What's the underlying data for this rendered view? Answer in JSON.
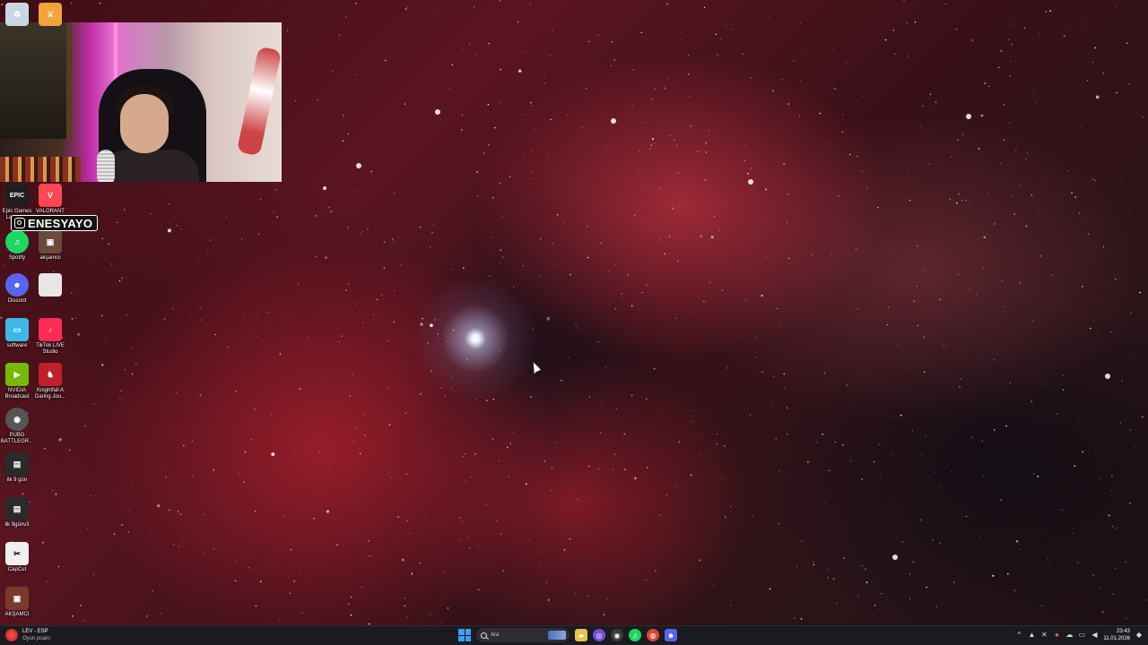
{
  "desktop": {
    "icons": [
      {
        "id": "recycle-bin",
        "label": "",
        "color": "#c9d7e4",
        "glyph": "♻"
      },
      {
        "id": "game-launcher-top",
        "label": "",
        "color": "#f2a33a",
        "glyph": "⚔"
      },
      {
        "id": "epic-games",
        "label": "Epic Games Launcher",
        "color": "#1f1f1f",
        "glyph": "EPIC"
      },
      {
        "id": "valorant",
        "label": "VALORANT",
        "color": "#ff4655",
        "glyph": "V"
      },
      {
        "id": "spotify",
        "label": "Spotify",
        "color": "#1ed760",
        "glyph": "♫"
      },
      {
        "id": "aksamcii",
        "label": "akşamcii",
        "color": "#6a4a3a",
        "glyph": "▣"
      },
      {
        "id": "discord",
        "label": "Discord",
        "color": "#5865f2",
        "glyph": "☻"
      },
      {
        "id": "blank-file",
        "label": "",
        "color": "#e6e6e6",
        "glyph": ""
      },
      {
        "id": "software",
        "label": "software",
        "color": "#3fb7e8",
        "glyph": "▭"
      },
      {
        "id": "tiktok-live-studio",
        "label": "TikTok LIVE Studio",
        "color": "#fe2c55",
        "glyph": "♪"
      },
      {
        "id": "nvidia-broadcast",
        "label": "NVIDIA Broadcast",
        "color": "#76b900",
        "glyph": "▶"
      },
      {
        "id": "knightfall",
        "label": "Knightfall A Daring Jou...",
        "color": "#c0202a",
        "glyph": "♞"
      },
      {
        "id": "pubg",
        "label": "PUBG BATTLEGR...",
        "color": "#555555",
        "glyph": "◉"
      },
      {
        "id": "ilk-9-gun",
        "label": "ilk 9 gün",
        "color": "#2a2a2a",
        "glyph": "▤"
      },
      {
        "id": "ilk-9-gun-3",
        "label": "ilk 9günv3",
        "color": "#2a2a2a",
        "glyph": "▤"
      },
      {
        "id": "capcut",
        "label": "CapCut",
        "color": "#f0f0f0",
        "glyph": "✂"
      },
      {
        "id": "aksamci",
        "label": "AKŞAMCI",
        "color": "#7a3a2a",
        "glyph": "▣"
      }
    ]
  },
  "overlay": {
    "instagram_handle": "ENESYAYO"
  },
  "taskbar": {
    "weather": {
      "title": "LEV - ESP",
      "subtitle": "Oyun puanı"
    },
    "search_placeholder": "Ara",
    "apps": [
      {
        "id": "file-explorer",
        "color": "#e8c34a",
        "glyph": "▰"
      },
      {
        "id": "app-purple",
        "color": "#7a4ae0",
        "glyph": "◎"
      },
      {
        "id": "obs",
        "color": "#3a3a3a",
        "glyph": "◉"
      },
      {
        "id": "spotify",
        "color": "#1ed760",
        "glyph": "♫"
      },
      {
        "id": "chrome",
        "color": "#db4437",
        "glyph": "◍"
      },
      {
        "id": "discord",
        "color": "#5865f2",
        "glyph": "☻"
      }
    ],
    "clock": {
      "time": "23:43",
      "date": "11.01.2026"
    }
  },
  "colors": {
    "taskbar_bg": "#1b1b1f",
    "accent_blue": "#3aa0ff"
  }
}
